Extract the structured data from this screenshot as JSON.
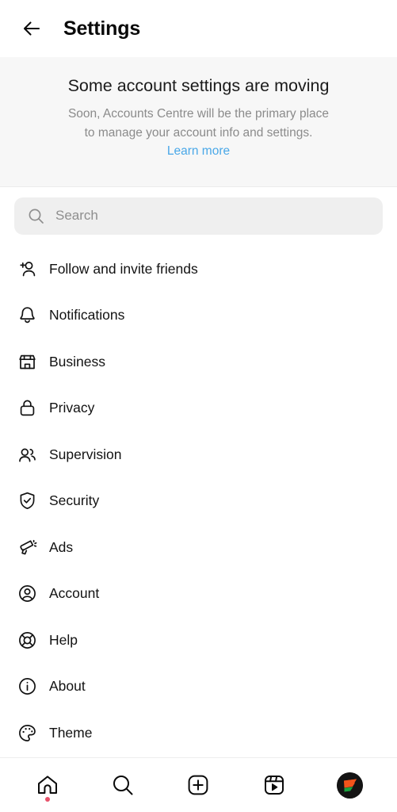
{
  "header": {
    "back_icon": "arrow-left-icon",
    "title": "Settings"
  },
  "banner": {
    "title": "Some account settings are moving",
    "line1": "Soon, Accounts Centre will be the primary place",
    "line2": "to manage your account info and settings.",
    "link_label": "Learn more",
    "link_color": "#4aa8e8",
    "background": "#f7f7f7"
  },
  "search": {
    "icon": "search-icon",
    "placeholder": "Search",
    "value": "",
    "background": "#efefef"
  },
  "menu": {
    "items": [
      {
        "label": "Follow and invite friends",
        "icon": "person-add-icon"
      },
      {
        "label": "Notifications",
        "icon": "bell-icon"
      },
      {
        "label": "Business",
        "icon": "store-icon"
      },
      {
        "label": "Privacy",
        "icon": "lock-icon"
      },
      {
        "label": "Supervision",
        "icon": "people-icon"
      },
      {
        "label": "Security",
        "icon": "shield-check-icon"
      },
      {
        "label": "Ads",
        "icon": "megaphone-icon"
      },
      {
        "label": "Account",
        "icon": "account-circle-icon"
      },
      {
        "label": "Help",
        "icon": "lifebuoy-icon"
      },
      {
        "label": "About",
        "icon": "info-circle-icon"
      },
      {
        "label": "Theme",
        "icon": "palette-icon"
      }
    ]
  },
  "bottom_nav": {
    "items": [
      {
        "name": "home",
        "icon": "home-icon",
        "badge_dot": true,
        "badge_color": "#e8526b"
      },
      {
        "name": "search",
        "icon": "search-icon",
        "badge_dot": false
      },
      {
        "name": "create",
        "icon": "plus-square-icon",
        "badge_dot": false
      },
      {
        "name": "reels",
        "icon": "reels-icon",
        "badge_dot": false
      },
      {
        "name": "profile",
        "icon": "profile-avatar",
        "badge_dot": false
      }
    ],
    "avatar_colors": {
      "base": "#141414",
      "orange": "#f2541b",
      "green": "#1aa33f",
      "white": "#f2f2f2"
    }
  }
}
